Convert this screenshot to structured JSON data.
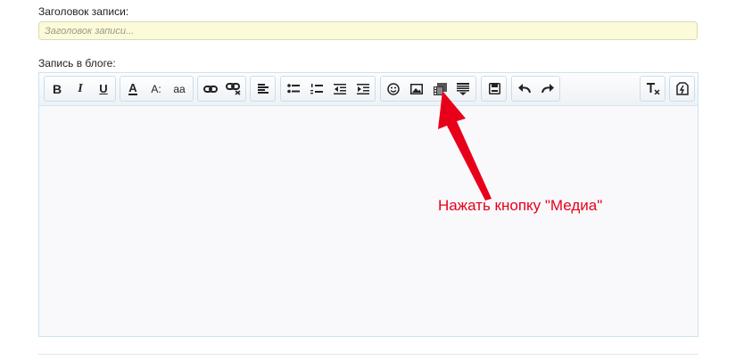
{
  "form": {
    "title_label": "Заголовок записи:",
    "title_placeholder": "Заголовок записи...",
    "title_value": "",
    "blog_label": "Запись в блоге:"
  },
  "toolbar": {
    "bold": "B",
    "italic": "I",
    "underline": "U",
    "font_color": "A",
    "font_size": "A:",
    "font_family": "aa"
  },
  "annotation": {
    "text": "Нажать кнопку \"Медиа\"",
    "color": "#e8001b"
  },
  "colors": {
    "accent_input_bg": "#fbfbd9",
    "editor_border": "#cbe3f0",
    "annotation_red": "#e8001b"
  }
}
